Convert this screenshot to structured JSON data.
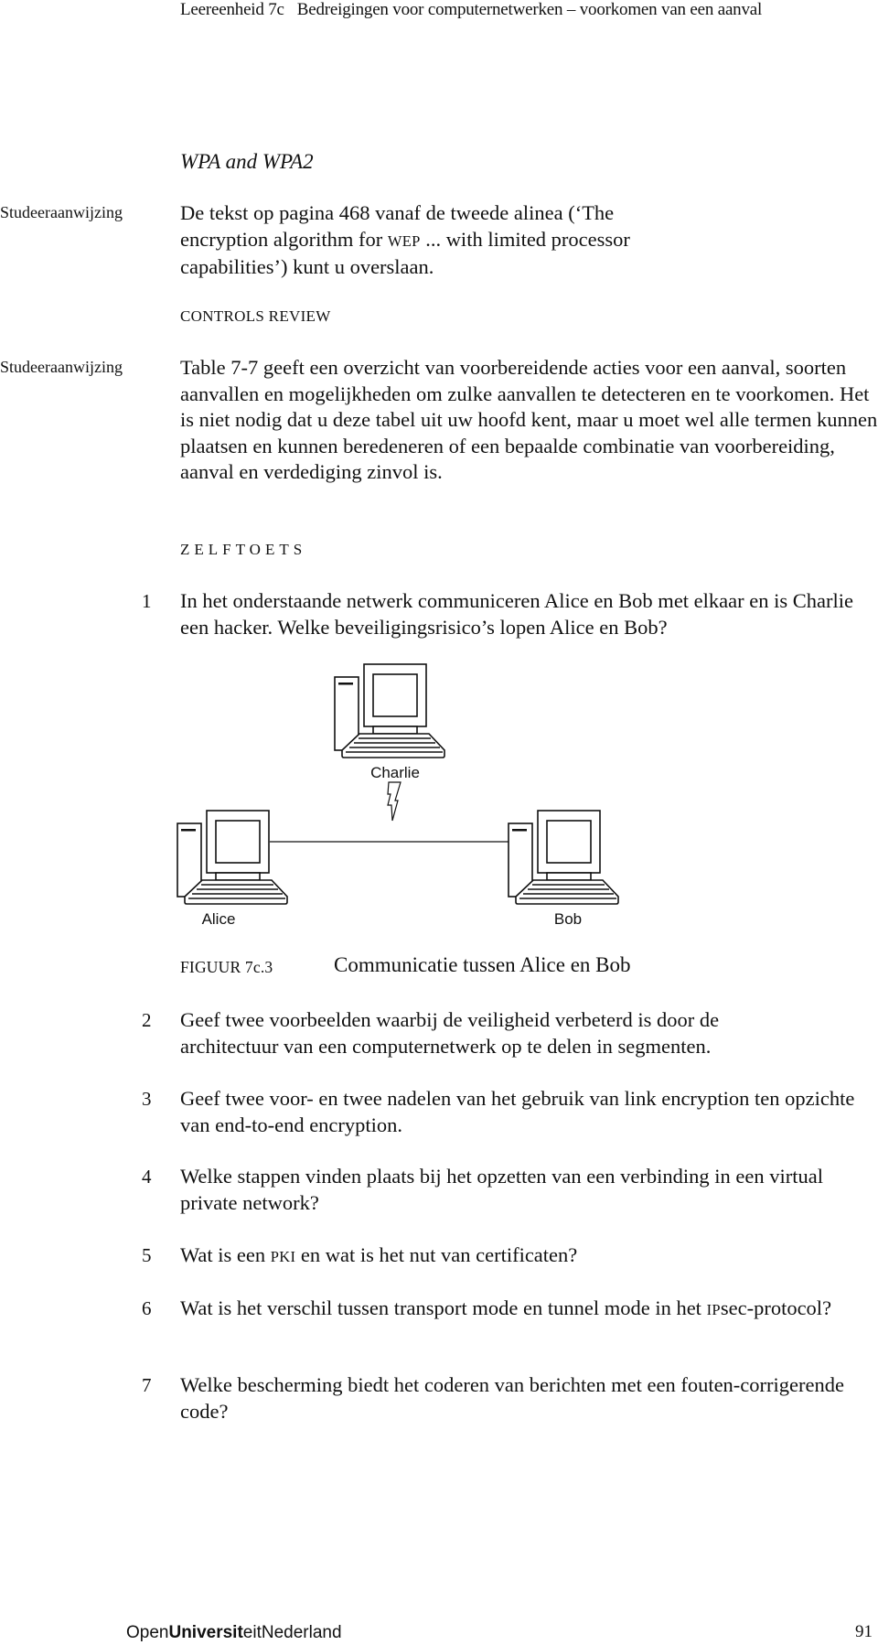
{
  "header": {
    "unit": "Leereenheid 7c",
    "title": "Bedreigingen voor computernetwerken – voorkomen van een aanval"
  },
  "section": {
    "title": "WPA and WPA2"
  },
  "study_notes": [
    {
      "label": "Studeeraanwijzing",
      "text_parts": [
        "De tekst op pagina 468 vanaf de tweede alinea (‘The encryption algorithm for ",
        "WEP",
        " ... with limited processor capabilities’) kunt u overslaan."
      ]
    },
    {
      "label": "Studeeraanwijzing",
      "text": "Table 7-7 geeft een overzicht van voorbereidende acties voor een aanval, soorten aanvallen en mogelijkheden om zulke aanvallen te detecteren en te voorkomen. Het is niet nodig dat u deze tabel uit uw hoofd kent, maar u moet wel alle termen kunnen plaatsen en kunnen beredeneren of een bepaalde combinatie van voorbereiding, aanval en verdediging zinvol is."
    }
  ],
  "subheading": "CONTROLS REVIEW",
  "selftest": {
    "title": "ZELFTOETS",
    "questions": [
      {
        "number": "1",
        "text": "In het onderstaande netwerk communiceren Alice en Bob met elkaar en is Charlie een hacker. Welke beveiligingsrisico’s lopen Alice en Bob?"
      },
      {
        "number": "2",
        "text": "Geef twee voorbeelden waarbij de veiligheid verbeterd is door de architectuur van een computernetwerk op te delen in segmenten."
      },
      {
        "number": "3",
        "text": "Geef twee voor- en twee nadelen van het gebruik van link encryption ten opzichte van end-to-end encryption."
      },
      {
        "number": "4",
        "text": "Welke stappen vinden plaats bij het opzetten van een verbinding in een virtual private network?"
      },
      {
        "number": "5",
        "text_parts": [
          "Wat is een ",
          "PKI",
          " en wat is het nut van certificaten?"
        ]
      },
      {
        "number": "6",
        "text_parts": [
          "Wat is het verschil tussen transport mode en tunnel mode in het ",
          "IP",
          "sec-protocol?"
        ]
      },
      {
        "number": "7",
        "text": "Welke bescherming biedt het coderen van berichten met een fouten-corrigerende code?"
      }
    ]
  },
  "figure": {
    "nodes": [
      {
        "name": "Charlie",
        "icon": "computer-icon"
      },
      {
        "name": "Alice",
        "icon": "computer-icon"
      },
      {
        "name": "Bob",
        "icon": "computer-icon"
      }
    ],
    "link": "Alice — Bob",
    "attack_icon": "lightning-bolt-icon",
    "caption_label": "FIGUUR 7c.3",
    "caption_text": "Communicatie tussen Alice en Bob"
  },
  "footer": {
    "logo_parts": [
      "Open",
      "Universit",
      "eit",
      "Nederland"
    ],
    "page_number": "91"
  }
}
